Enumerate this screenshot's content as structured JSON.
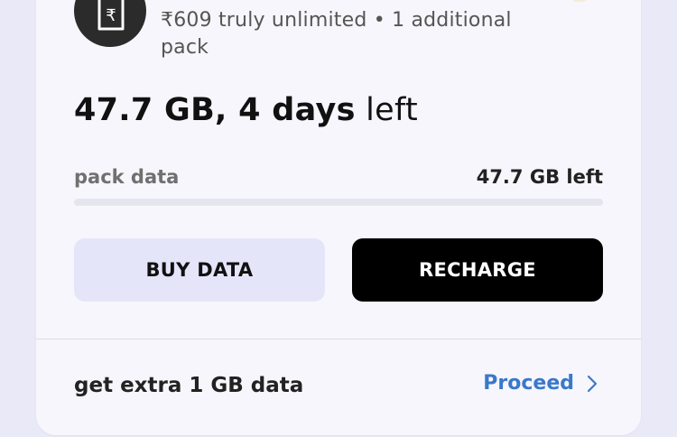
{
  "plan": {
    "icon": "rupee-sim-icon",
    "description": "₹609 truly unlimited • 1 additional pack"
  },
  "summary": {
    "amount": "47.7 GB, 4 days",
    "suffix": " left"
  },
  "pack_data": {
    "label": "pack data",
    "remaining": "47.7 GB left",
    "progress_fraction": 0
  },
  "buttons": {
    "buy_data": "BUY DATA",
    "recharge": "RECHARGE"
  },
  "extra": {
    "label": "get extra 1 GB data",
    "action": "Proceed",
    "action_icon": "chevron-right-icon"
  },
  "colors": {
    "link": "#3a78c9",
    "primary_button": "#000000",
    "secondary_button": "#e5e5fa"
  }
}
